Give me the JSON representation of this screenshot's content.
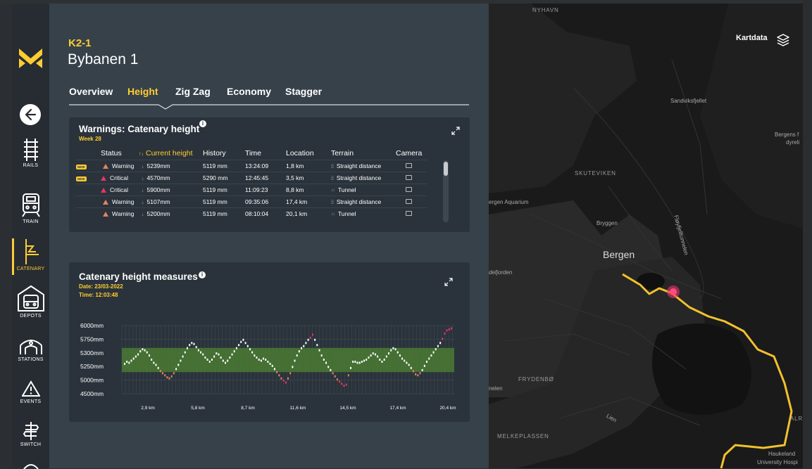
{
  "app": {
    "logo": "M-logo"
  },
  "sidebar": {
    "items": [
      {
        "label": "RAILS",
        "icon": "rails-icon"
      },
      {
        "label": "TRAIN",
        "icon": "train-icon"
      },
      {
        "label": "CATENARY",
        "icon": "catenary-icon",
        "active": true
      },
      {
        "label": "DEPOTS",
        "icon": "depot-icon"
      },
      {
        "label": "STATIONS",
        "icon": "station-icon"
      },
      {
        "label": "EVENTS",
        "icon": "warning-icon"
      },
      {
        "label": "SWITCH",
        "icon": "switch-icon"
      }
    ]
  },
  "header": {
    "code": "K2-1",
    "title": "Bybanen 1"
  },
  "tabs": [
    {
      "label": "Overview"
    },
    {
      "label": "Height",
      "active": true
    },
    {
      "label": "Zig Zag"
    },
    {
      "label": "Economy"
    },
    {
      "label": "Stagger"
    }
  ],
  "warnings": {
    "title": "Warnings: Catenary height",
    "subtitle": "Week 28",
    "columns": [
      "Status",
      "Current height",
      "History",
      "Time",
      "Location",
      "Terrain",
      "Camera"
    ],
    "sort_glyph": "↑↓",
    "rows": [
      {
        "new": "NEW",
        "status": "Warning",
        "height": "5239mm",
        "history": "5119 mm",
        "time": "13:24:09",
        "location": "1,8 km",
        "terrain": "Straight distance",
        "terrain_icon": "straight-icon"
      },
      {
        "new": "NEW",
        "status": "Critical",
        "height": "4570mm",
        "history": "5290 mm",
        "time": "12:45:45",
        "location": "3,5 km",
        "terrain": "Straight distance",
        "terrain_icon": "straight-icon"
      },
      {
        "new": "",
        "status": "Critical",
        "height": "5900mm",
        "history": "5119 mm",
        "time": "11:09:23",
        "location": "8,8 km",
        "terrain": "Tunnel",
        "terrain_icon": "tunnel-icon"
      },
      {
        "new": "",
        "status": "Warning",
        "height": "5107mm",
        "history": "5119 mm",
        "time": "09:35:06",
        "location": "17,4 km",
        "terrain": "Straight distance",
        "terrain_icon": "straight-icon"
      },
      {
        "new": "",
        "status": "Warning",
        "height": "5200mm",
        "history": "5119 mm",
        "time": "08:10:04",
        "location": "20,1 km",
        "terrain": "Tunnel",
        "terrain_icon": "tunnel-icon"
      }
    ]
  },
  "measures": {
    "title": "Catenary height measures",
    "date": "Date: 23/03-2022",
    "time": "Time: 12:03:48"
  },
  "chart_data": {
    "type": "scatter",
    "title": "",
    "xlabel": "",
    "ylabel": "",
    "y_tick_labels": [
      "6000mm",
      "5750mm",
      "5300mm",
      "5250mm",
      "5000mm",
      "4500mm"
    ],
    "x_tick_labels": [
      "2,9 km",
      "5,8 km",
      "8,7 km",
      "11,6 km",
      "14,5 km",
      "17,4 km",
      "20,4 km"
    ],
    "band": {
      "from_tick": "5300mm",
      "to_tick": "5250mm",
      "color": "#4a7a33"
    },
    "series": [
      {
        "values": [
          2.6,
          2.8,
          2.7,
          2.9,
          3.1,
          3.3,
          3.5,
          3.8,
          4.0,
          3.9,
          3.7,
          3.4,
          3.0,
          2.7,
          2.5,
          2.2,
          1.9,
          1.7,
          1.5,
          1.3,
          1.2,
          1.4,
          1.7,
          2.1,
          2.5,
          2.9,
          3.3,
          3.7,
          4.1,
          4.4,
          4.6,
          4.5,
          4.2,
          3.9,
          3.7,
          3.5,
          3.2,
          3.0,
          2.8,
          3.0,
          3.3,
          3.6,
          3.5,
          3.2,
          2.9,
          2.7,
          2.9,
          3.2,
          3.5,
          3.8,
          4.1,
          4.4,
          4.7,
          4.9,
          4.6,
          4.3,
          4.0,
          3.7,
          3.4,
          3.2,
          3.0,
          2.9,
          3.1,
          3.0,
          2.8,
          2.6,
          2.4,
          2.1,
          1.8,
          1.5,
          1.2,
          1.0,
          0.8,
          1.2,
          1.7,
          2.3,
          2.9,
          3.4,
          3.8,
          4.1,
          4.3,
          4.6,
          4.9,
          5.1,
          5.4,
          4.9,
          4.4,
          3.9,
          3.4,
          3.0,
          2.7,
          2.3,
          2.0,
          1.7,
          1.4,
          1.1,
          0.9,
          0.7,
          0.5,
          0.6,
          1.5,
          2.2,
          2.8,
          2.8,
          2.7,
          2.7,
          2.8,
          2.9,
          3.0,
          3.2,
          3.4,
          3.6,
          3.5,
          3.3,
          3.0,
          2.8,
          3.0,
          3.3,
          3.6,
          3.9,
          4.1,
          4.0,
          3.7,
          3.4,
          3.1,
          2.9,
          2.7,
          2.5,
          2.2,
          1.9,
          1.6,
          1.5,
          1.7,
          2.0,
          2.4,
          2.8,
          3.1,
          3.4,
          3.7,
          4.0,
          4.3,
          4.6,
          5.0,
          5.5,
          5.8,
          5.9,
          6.0
        ]
      }
    ],
    "colors": {
      "normal": "#ffffff",
      "warning": "#e8825a",
      "critical": "#e8336a",
      "grid": "#4a5158"
    }
  },
  "map": {
    "layer_label": "Kartdata",
    "layer_icon": "layers-icon",
    "places": [
      {
        "name": "NYHAVN",
        "style": "caps"
      },
      {
        "name": "Sandviksfjellet",
        "style": "small"
      },
      {
        "name": "Bergens f",
        "style": "small"
      },
      {
        "name": "dyreli",
        "style": "small"
      },
      {
        "name": "SKUTEVIKEN",
        "style": "caps"
      },
      {
        "name": "ergen Aquarium",
        "style": "small"
      },
      {
        "name": "Bryggen",
        "style": "small"
      },
      {
        "name": "Fløyfjelltunnelen",
        "style": "small"
      },
      {
        "name": "Bergen",
        "style": "big"
      },
      {
        "name": "defjorden",
        "style": "small"
      },
      {
        "name": "FRYDENBØ",
        "style": "caps"
      },
      {
        "name": "nelen",
        "style": "small"
      },
      {
        "name": "Lien",
        "style": "small"
      },
      {
        "name": "MELKEPLASSEN",
        "style": "caps"
      },
      {
        "name": "ALR",
        "style": "caps"
      },
      {
        "name": "Haukeland",
        "style": "small"
      },
      {
        "name": "University Hospi",
        "style": "small"
      }
    ]
  }
}
